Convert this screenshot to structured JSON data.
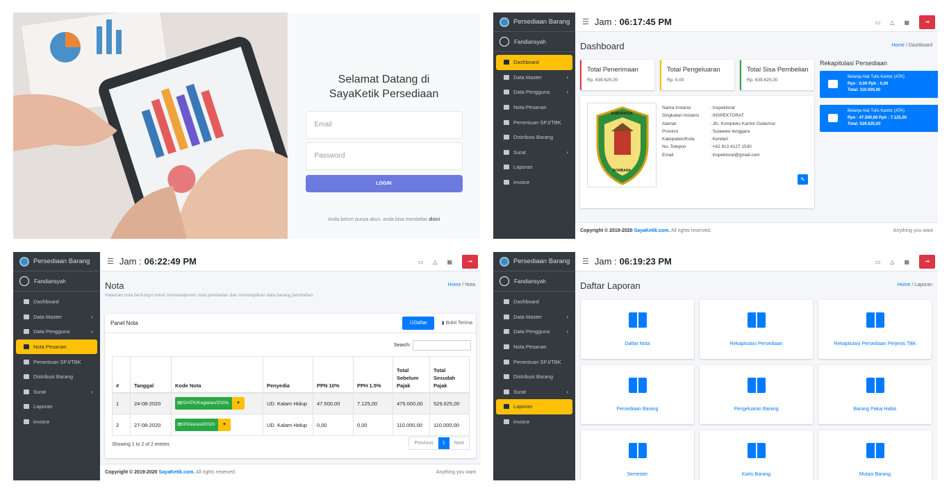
{
  "login": {
    "title_line1": "Selamat Datang di",
    "title_line2": "SayaKetik Persediaan",
    "email_placeholder": "Email",
    "password_placeholder": "Password",
    "login_button": "LOGIN",
    "register_text": "Anda belum punya akun. anda bisa mendaftar",
    "register_link": "disini"
  },
  "sidebar": {
    "brand": "Persediaan Barang",
    "user": "Fandiansyah",
    "items": [
      {
        "label": "Dashboard"
      },
      {
        "label": "Data Master",
        "arrow": "‹"
      },
      {
        "label": "Data Pengguna",
        "arrow": "‹"
      },
      {
        "label": "Nota Pesanan"
      },
      {
        "label": "Penentuan SPJ/TBK"
      },
      {
        "label": "Distribusi Barang"
      },
      {
        "label": "Surat",
        "arrow": "‹"
      },
      {
        "label": "Laporan"
      },
      {
        "label": "invoice"
      }
    ]
  },
  "dashboard": {
    "clock_label": "Jam :",
    "clock": "06:17:45 PM",
    "title": "Dashboard",
    "breadcrumb_home": "Home",
    "breadcrumb_current": "Dashboard",
    "stats": [
      {
        "title": "Total Penerimaan",
        "value": "Rp. 639.625,00",
        "color": "#dc3545"
      },
      {
        "title": "Total Pengeluaran",
        "value": "Rp. 0,00",
        "color": "#ffc107"
      },
      {
        "title": "Total Sisa Pembelian",
        "value": "Rp. 639.625,00",
        "color": "#28a745"
      }
    ],
    "rekap_title": "Rekapitulasi Persediaan",
    "rekap": [
      {
        "line1": "Belanja Alat Tulis Kantor (ATK)",
        "line2": "Ppn : 0,00         Pph : 0,00",
        "line3": "Total: 110.000,00"
      },
      {
        "line1": "Belanja Alat Tulis Kantor (ATK)",
        "line2": "Ppn : 47.500,00     Pph : 7.125,00",
        "line3": "Total: 529.625,00"
      }
    ],
    "logo_text_top": "KABUPATEN",
    "logo_text_bottom": "BOMBANA",
    "instansi": [
      {
        "k": "Nama Instansi",
        "v": ": Inspektorat"
      },
      {
        "k": "Singkatan Instansi",
        "v": ": INSPEKTORAT"
      },
      {
        "k": "Alamat",
        "v": ": Jln. Kompleks Kantor Gubernur"
      },
      {
        "k": "Provinsi",
        "v": ": Sulawesi tenggara"
      },
      {
        "k": "Kabupaten/Kota",
        "v": ": Kendari"
      },
      {
        "k": "No. Telepon",
        "v": ": +62 813 4127 1530"
      },
      {
        "k": "Email",
        "v": ": inspektorat@gmail.com"
      }
    ],
    "footer_copy": "Copyright © 2019-2020",
    "footer_site": "SayaKetik.com.",
    "footer_rights": "All rights reserved.",
    "footer_right": "Anything you want"
  },
  "nota": {
    "clock_label": "Jam :",
    "clock": "06:22:49 PM",
    "title": "Nota",
    "subtitle": "Halaman nota berfungsi untuk memanejemen nota pembelian dan menampilkan data barang pembelian.",
    "breadcrumb_home": "Home",
    "breadcrumb_current": "Nota",
    "panel_title": "Panel Nota",
    "tab_daftar": "Daftar",
    "tab_bukti": "Bukti Terima",
    "search_label": "Search:",
    "columns": [
      "#",
      "Tanggal",
      "Kode Nota",
      "Penyedia",
      "PPN 10%",
      "PPH 1.5%",
      "Total Sebelum Pajak",
      "Total Sesudah Pajak"
    ],
    "rows": [
      {
        "no": "1",
        "tanggal": "24-08-2020",
        "kode": "02/ATK/Kegiatan/2020s",
        "penyedia": "UD. Kalam Hidup",
        "ppn": "47.500,00",
        "pph": "7.125,00",
        "sebelum": "475.000,00",
        "sesudah": "529.625,00"
      },
      {
        "no": "2",
        "tanggal": "27-08-2020",
        "kode": "003/as/asd/2020",
        "penyedia": "UD. Kalam Hidup",
        "ppn": "0,00",
        "pph": "0,00",
        "sebelum": "110.000,00",
        "sesudah": "110.000,00"
      }
    ],
    "showing": "Showing 1 to 2 of 2 entries",
    "prev": "Previous",
    "page": "1",
    "next": "Next"
  },
  "laporan": {
    "clock_label": "Jam :",
    "clock": "06:19:23 PM",
    "title": "Daftar Laporan",
    "breadcrumb_home": "Home",
    "breadcrumb_current": "Laporan",
    "items": [
      "Daftar Nota",
      "Rekapitulasi Persediaan",
      "Rekapitulasi Persediaan Perjenis TBK",
      "Persediaan Barang",
      "Pengeluaran Barang",
      "Barang Pakai Habis",
      "Semester",
      "Kartu Barang",
      "Mutasi Barang"
    ]
  },
  "colors": {
    "sidebar": "#343a40",
    "active": "#ffc107",
    "primary": "#007bff",
    "login_button": "#6c7ae0",
    "logout": "#dc3545"
  }
}
